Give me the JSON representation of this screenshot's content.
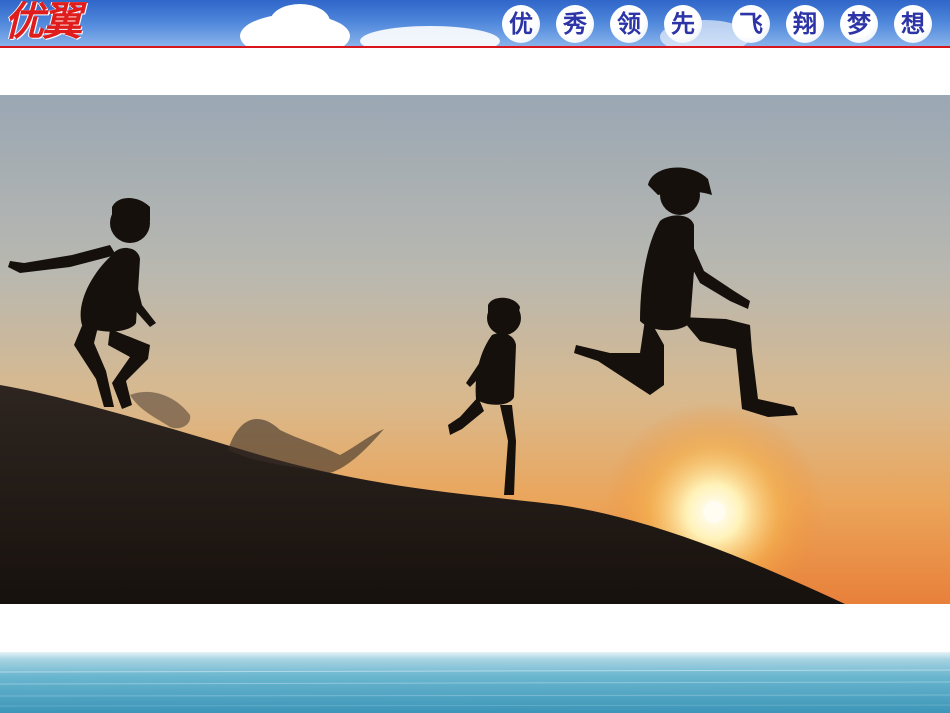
{
  "banner": {
    "brand": "优翼",
    "slogan_left": [
      "优",
      "秀",
      "领",
      "先"
    ],
    "slogan_right": [
      "飞",
      "翔",
      "梦",
      "想"
    ]
  },
  "photo": {
    "subject": "photo"
  },
  "colors": {
    "banner_blue": "#3a6fd0",
    "brand_red": "#e01d1d",
    "slogan_text": "#2c34a8",
    "sunset_orange": "#f2a13c",
    "sea_blue": "#4aa3c4"
  }
}
